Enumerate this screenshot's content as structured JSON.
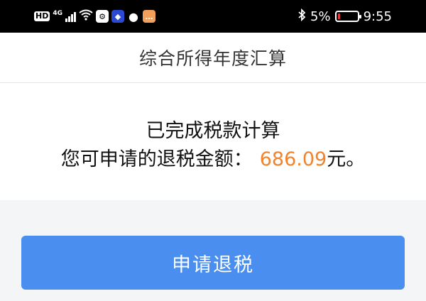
{
  "status_bar": {
    "hd": "HD",
    "network": "4G",
    "battery_percent": "5%",
    "time": "9:55",
    "icons": [
      "hd-icon",
      "signal-icon",
      "wifi-icon",
      "app-icon",
      "app-icon",
      "chat-icon",
      "app-icon",
      "bluetooth-icon",
      "battery-icon"
    ]
  },
  "header": {
    "title": "综合所得年度汇算"
  },
  "result": {
    "status": "已完成税款计算",
    "refund_label": "您可申请的退税金额：",
    "refund_amount": "686.09",
    "refund_unit": "元。",
    "amount_color": "#f0832c"
  },
  "actions": {
    "apply_refund_label": "申请退税",
    "button_color": "#4a8ff0"
  }
}
